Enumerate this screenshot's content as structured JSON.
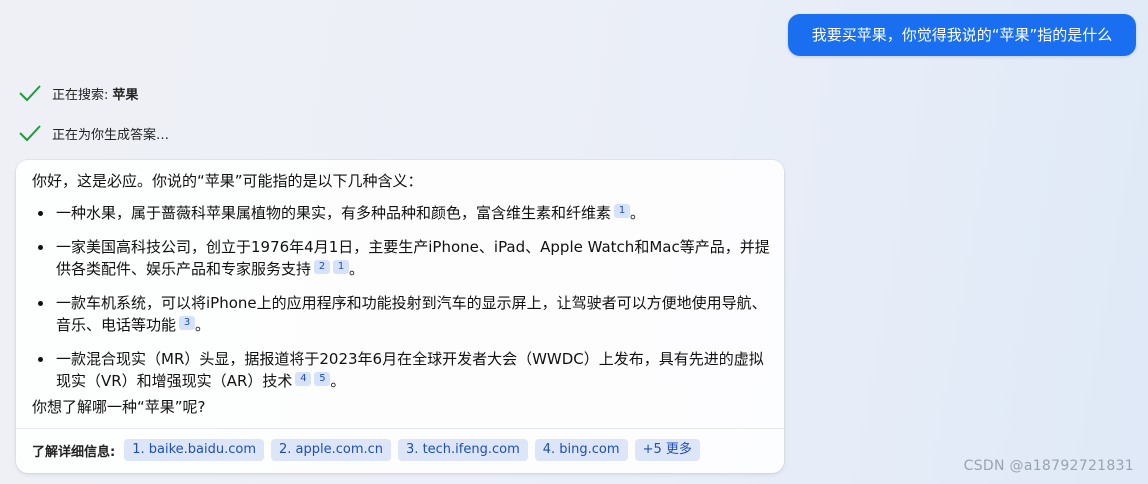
{
  "user_message": "我要买苹果，你觉得我说的“苹果”指的是什么",
  "status": [
    {
      "prefix": "正在搜索:",
      "bold": "苹果"
    },
    {
      "prefix": "正在为你生成答案…",
      "bold": ""
    }
  ],
  "answer": {
    "intro": "你好，这是必应。你说的“苹果”可能指的是以下几种含义：",
    "items": [
      {
        "text": "一种水果，属于蔷薇科苹果属植物的果实，有多种品种和颜色，富含维生素和纤维素",
        "cites": [
          "1"
        ],
        "end": "。"
      },
      {
        "text": "一家美国高科技公司，创立于1976年4月1日，主要生产iPhone、iPad、Apple Watch和Mac等产品，并提供各类配件、娱乐产品和专家服务支持",
        "cites": [
          "2",
          "1"
        ],
        "end": "。"
      },
      {
        "text": "一款车机系统，可以将iPhone上的应用程序和功能投射到汽车的显示屏上，让驾驶者可以方便地使用导航、音乐、电话等功能",
        "cites": [
          "3"
        ],
        "end": "。"
      },
      {
        "text": "一款混合现实（MR）头显，据报道将于2023年6月在全球开发者大会（WWDC）上发布，具有先进的虚拟现实（VR）和增强现实（AR）技术",
        "cites": [
          "4",
          "5"
        ],
        "end": "。"
      }
    ],
    "outro": "你想了解哪一种“苹果”呢?"
  },
  "learn_more": {
    "label": "了解详细信息:",
    "links": [
      "1. baike.baidu.com",
      "2. apple.com.cn",
      "3. tech.ifeng.com",
      "4. bing.com",
      "+5 更多"
    ]
  },
  "watermark": "CSDN @a18792721831",
  "colors": {
    "accent": "#1a6ff0",
    "check": "#1f9d3a",
    "chip_bg": "#dde6f8",
    "chip_text": "#1f4fb5"
  }
}
